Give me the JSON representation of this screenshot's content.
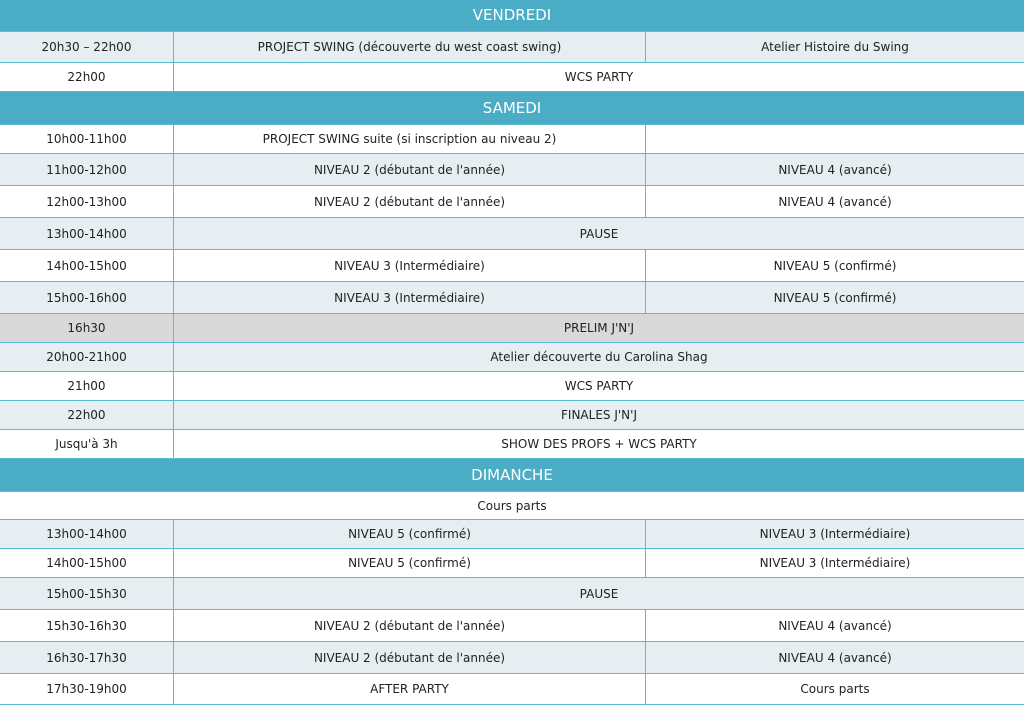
{
  "days": {
    "vendredi": "VENDREDI",
    "samedi": "SAMEDI",
    "dimanche": "DIMANCHE"
  },
  "vendredi": {
    "r1": {
      "time": "20h30 – 22h00",
      "a": "PROJECT SWING (découverte du west coast swing)",
      "b": "Atelier Histoire du Swing"
    },
    "r2": {
      "time": "22h00",
      "span": "WCS PARTY"
    }
  },
  "samedi": {
    "r1": {
      "time": "10h00-11h00",
      "a": "PROJECT SWING suite (si inscription au niveau 2)",
      "b": ""
    },
    "r2": {
      "time": "11h00-12h00",
      "a": "NIVEAU 2 (débutant de l'année)",
      "b": "NIVEAU 4 (avancé)"
    },
    "r3": {
      "time": "12h00-13h00",
      "a": "NIVEAU 2 (débutant de l'année)",
      "b": "NIVEAU 4 (avancé)"
    },
    "r4": {
      "time": "13h00-14h00",
      "span": "PAUSE"
    },
    "r5": {
      "time": "14h00-15h00",
      "a": "NIVEAU 3 (Intermédiaire)",
      "b": "NIVEAU 5 (confirmé)"
    },
    "r6": {
      "time": "15h00-16h00",
      "a": "NIVEAU 3 (Intermédiaire)",
      "b": "NIVEAU 5 (confirmé)"
    },
    "r7": {
      "time": "16h30",
      "span": "PRELIM J'N'J"
    },
    "r8": {
      "time": "20h00-21h00",
      "span": "Atelier découverte du Carolina Shag"
    },
    "r9": {
      "time": "21h00",
      "span": "WCS PARTY"
    },
    "r10": {
      "time": "22h00",
      "span": "FINALES J'N'J"
    },
    "r11": {
      "time": "Jusqu'à 3h",
      "span": "SHOW DES PROFS + WCS PARTY"
    }
  },
  "dimanche": {
    "r0": {
      "full": "Cours parts"
    },
    "r1": {
      "time": "13h00-14h00",
      "a": "NIVEAU 5 (confirmé)",
      "b": "NIVEAU 3 (Intermédiaire)"
    },
    "r2": {
      "time": "14h00-15h00",
      "a": "NIVEAU 5 (confirmé)",
      "b": "NIVEAU 3 (Intermédiaire)"
    },
    "r3": {
      "time": "15h00-15h30",
      "span": "PAUSE"
    },
    "r4": {
      "time": "15h30-16h30",
      "a": "NIVEAU 2 (débutant de l'année)",
      "b": "NIVEAU 4 (avancé)"
    },
    "r5": {
      "time": "16h30-17h30",
      "a": "NIVEAU 2 (débutant de l'année)",
      "b": "NIVEAU 4 (avancé)"
    },
    "r6": {
      "time": "17h30-19h00",
      "a": "AFTER PARTY",
      "b": "Cours parts"
    }
  }
}
